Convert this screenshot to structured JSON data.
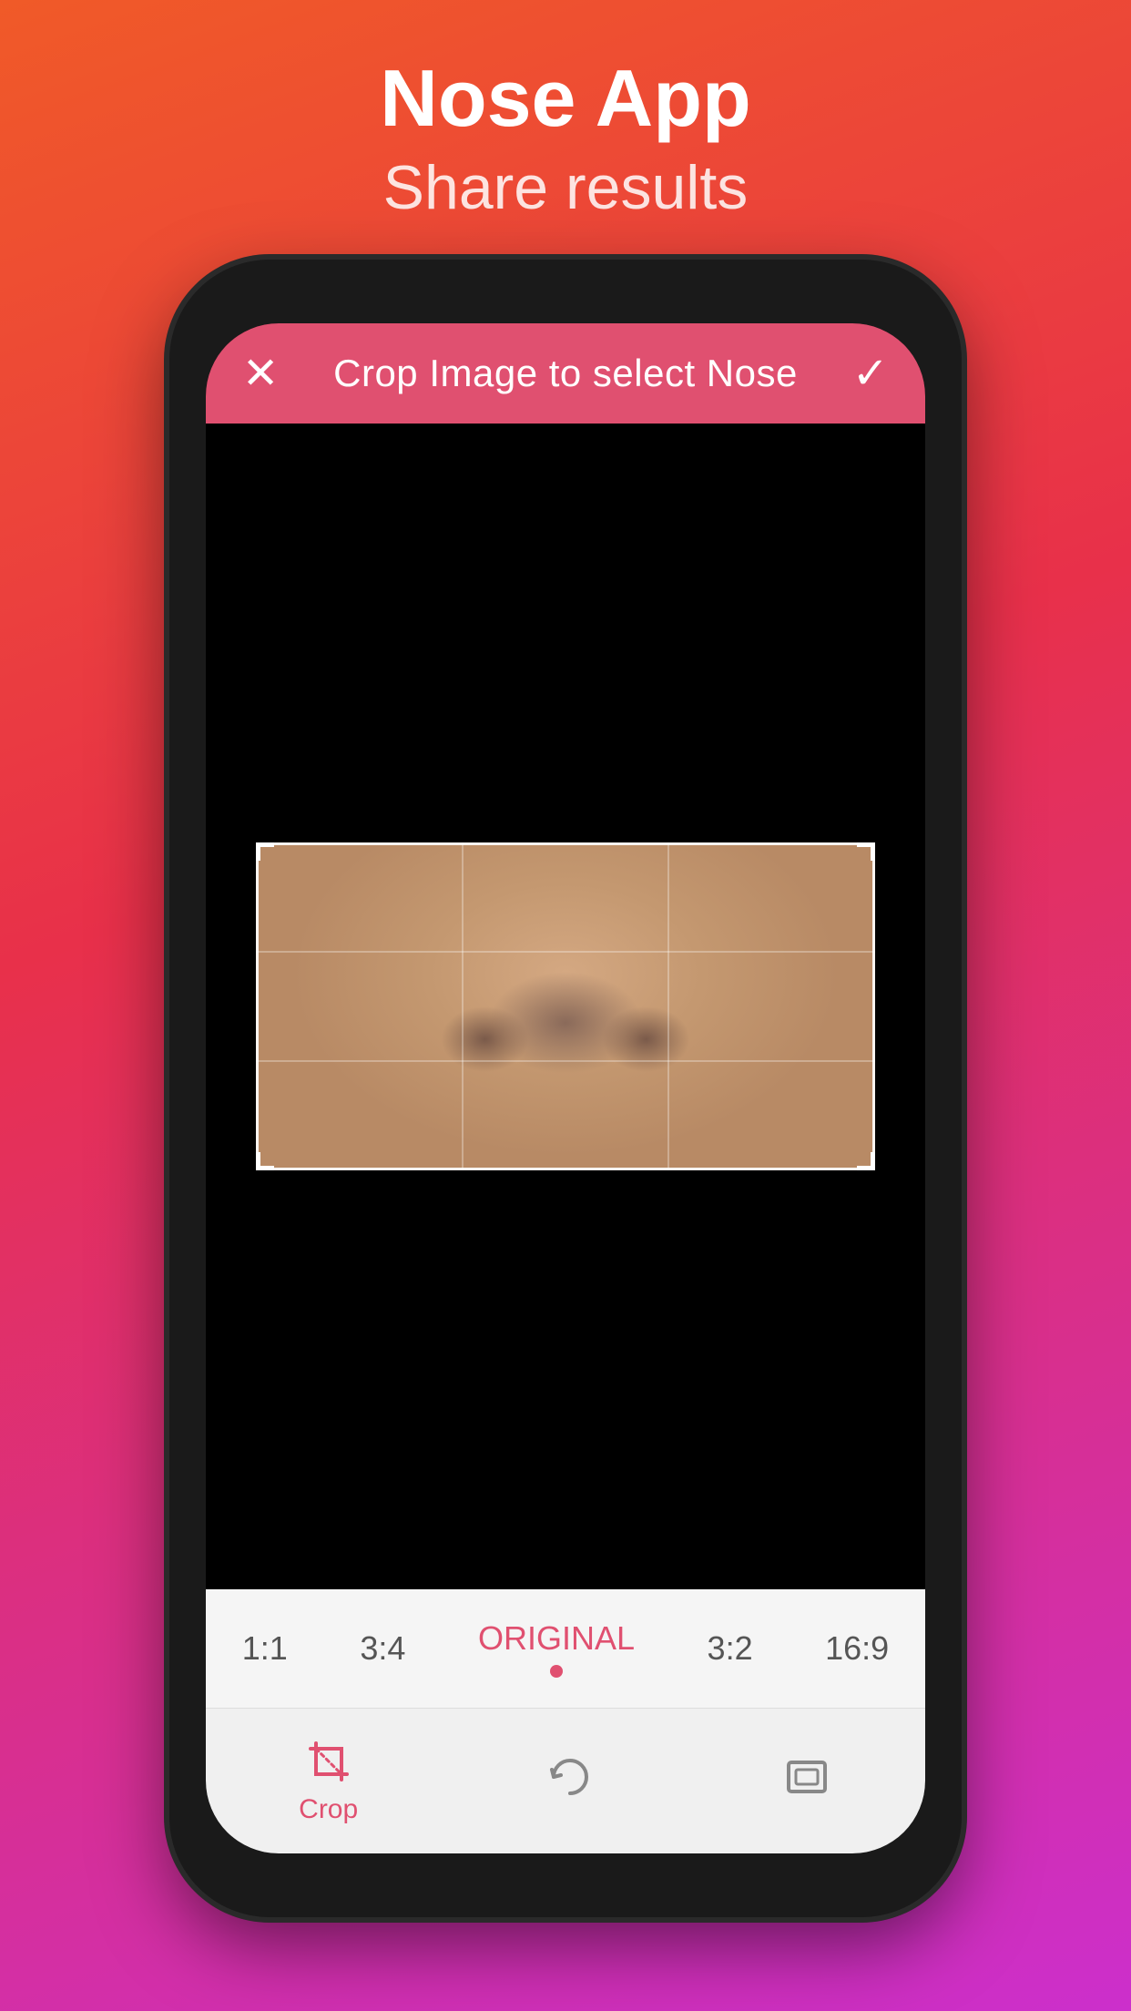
{
  "header": {
    "app_title": "Nose App",
    "app_subtitle": "Share results"
  },
  "crop_screen": {
    "header_title": "Crop Image to select Nose",
    "close_icon": "✕",
    "confirm_icon": "✓",
    "ratio_options": [
      {
        "label": "1:1",
        "active": false
      },
      {
        "label": "3:4",
        "active": false
      },
      {
        "label": "ORIGINAL",
        "active": true
      },
      {
        "label": "3:2",
        "active": false
      },
      {
        "label": "16:9",
        "active": false
      }
    ],
    "action_bar": [
      {
        "label": "Crop",
        "active": true
      },
      {
        "label": "",
        "active": false
      },
      {
        "label": "",
        "active": false
      }
    ]
  },
  "colors": {
    "header_bg": "#e05070",
    "active_color": "#e05070",
    "background_gradient_start": "#f05a28",
    "background_gradient_end": "#cc2fcc"
  }
}
